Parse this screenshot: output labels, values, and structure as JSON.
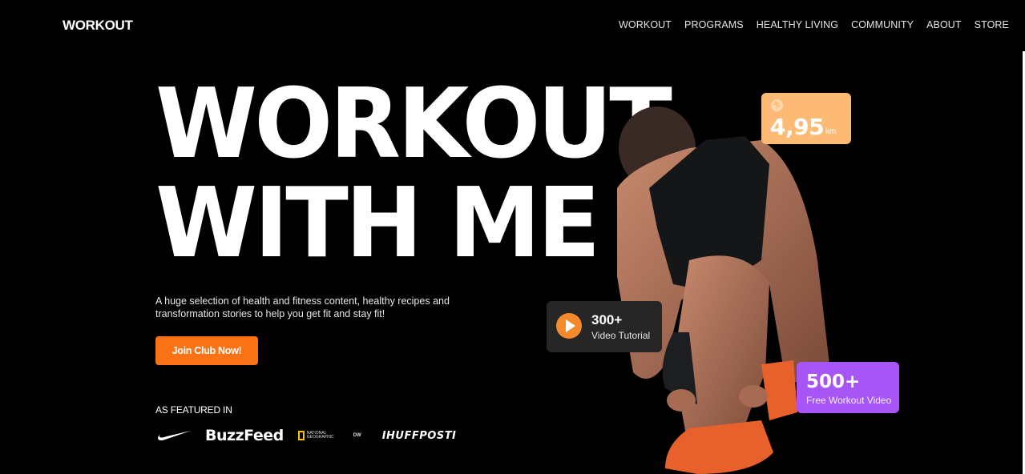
{
  "header": {
    "logo": "WORKOUT",
    "nav": [
      "WORKOUT",
      "PROGRAMS",
      "HEALTHY LIVING",
      "COMMUNITY",
      "ABOUT",
      "STORE"
    ]
  },
  "hero": {
    "title_line1": "WORKOUT",
    "title_line2": "WITH ME",
    "description": "A huge selection of health and fitness content, healthy recipes and transformation stories to help you get fit and stay fit!",
    "cta_label": "Join Club Now!",
    "featured_label": "AS FEATURED IN",
    "featured_logos": [
      "Nike",
      "BuzzFeed",
      "National Geographic",
      "DW",
      "IHUFFPOSTI"
    ],
    "natgeo_text": "NATIONAL GEOGRAPHIC",
    "dw_text": "DW"
  },
  "stats": {
    "distance": {
      "value": "4,95",
      "unit": "km",
      "icon": "running-icon",
      "color": "#fdba74"
    },
    "videos": {
      "value": "300+",
      "label": "Video Tutorial",
      "icon": "play-icon",
      "color": "#262626",
      "accent": "#f58a2c"
    },
    "free": {
      "value": "500+",
      "label": "Free Workout Video",
      "color": "#a855f7"
    }
  },
  "colors": {
    "background": "#000000",
    "cta": "#f97316"
  }
}
